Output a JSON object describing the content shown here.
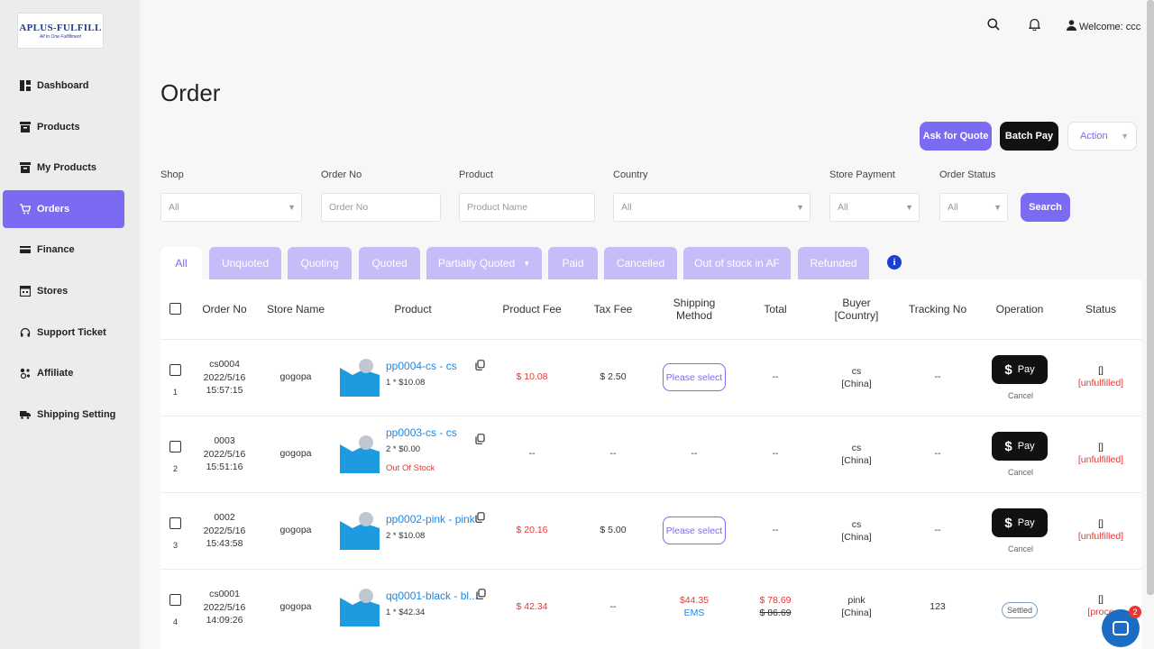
{
  "logo": {
    "line1": "APLUS-FULFILL",
    "line2": "All In One Fulfillment"
  },
  "sidebar": {
    "items": [
      {
        "label": "Dashboard",
        "icon": "dashboard-icon"
      },
      {
        "label": "Products",
        "icon": "box-icon"
      },
      {
        "label": "My Products",
        "icon": "box-icon"
      },
      {
        "label": "Orders",
        "icon": "cart-icon",
        "active": true
      },
      {
        "label": "Finance",
        "icon": "card-icon"
      },
      {
        "label": "Stores",
        "icon": "store-icon"
      },
      {
        "label": "Support Ticket",
        "icon": "headset-icon"
      },
      {
        "label": "Affiliate",
        "icon": "affiliate-icon"
      },
      {
        "label": "Shipping Setting",
        "icon": "truck-icon"
      }
    ]
  },
  "header": {
    "welcome": "Welcome:  ccc"
  },
  "page": {
    "title": "Order"
  },
  "actions": {
    "quote": "Ask for Quote",
    "batch_pay": "Batch Pay",
    "action": "Action"
  },
  "filters": {
    "shop": {
      "label": "Shop",
      "value": "All"
    },
    "order_no": {
      "label": "Order No",
      "placeholder": "Order No"
    },
    "product": {
      "label": "Product",
      "placeholder": "Product Name"
    },
    "country": {
      "label": "Country",
      "value": "All"
    },
    "store_payment": {
      "label": "Store Payment",
      "value": "All"
    },
    "order_status": {
      "label": "Order Status",
      "value": "All"
    },
    "search": "Search"
  },
  "tabs": [
    "All",
    "Unquoted",
    "Quoting",
    "Quoted",
    "Partially Quoted",
    "Paid",
    "Cancelled",
    "Out of stock in AF",
    "Refunded"
  ],
  "table": {
    "headers": {
      "order_no": "Order No",
      "store": "Store Name",
      "product": "Product",
      "product_fee": "Product Fee",
      "tax_fee": "Tax Fee",
      "shipping1": "Shipping",
      "shipping2": "Method",
      "total": "Total",
      "buyer1": "Buyer",
      "buyer2": "[Country]",
      "tracking": "Tracking No",
      "operation": "Operation",
      "status": "Status"
    },
    "rows": [
      {
        "num": "1",
        "order_no": "cs0004",
        "date": "2022/5/16",
        "time": "15:57:15",
        "store": "gogopa",
        "product": "pp0004-cs - cs",
        "qty": "1 * $10.08",
        "oos": "",
        "product_fee": "$ 10.08",
        "tax_fee": "$ 2.50",
        "shipping": "Please select",
        "ship_cost": "",
        "total": "--",
        "total_old": "",
        "buyer": "cs",
        "country": "[China]",
        "tracking": "--",
        "op": "Pay",
        "cancel": "Cancel",
        "status_top": "[]",
        "status": "[unfulfilled]"
      },
      {
        "num": "2",
        "order_no": "0003",
        "date": "2022/5/16",
        "time": "15:51:16",
        "store": "gogopa",
        "product": "pp0003-cs - cs",
        "qty": "2 * $0.00",
        "oos": "Out Of Stock",
        "product_fee": "--",
        "tax_fee": "--",
        "shipping": "--",
        "ship_cost": "",
        "total": "--",
        "total_old": "",
        "buyer": "cs",
        "country": "[China]",
        "tracking": "--",
        "op": "Pay",
        "cancel": "Cancel",
        "status_top": "[]",
        "status": "[unfulfilled]"
      },
      {
        "num": "3",
        "order_no": "0002",
        "date": "2022/5/16",
        "time": "15:43:58",
        "store": "gogopa",
        "product": "pp0002-pink - pink",
        "qty": "2 * $10.08",
        "oos": "",
        "product_fee": "$ 20.16",
        "tax_fee": "$ 5.00",
        "shipping": "Please select",
        "ship_cost": "",
        "total": "--",
        "total_old": "",
        "buyer": "cs",
        "country": "[China]",
        "tracking": "--",
        "op": "Pay",
        "cancel": "Cancel",
        "status_top": "[]",
        "status": "[unfulfilled]"
      },
      {
        "num": "4",
        "order_no": "cs0001",
        "date": "2022/5/16",
        "time": "14:09:26",
        "store": "gogopa",
        "product": "qq0001-black - bl...",
        "qty": "1 * $42.34",
        "oos": "",
        "product_fee": "$ 42.34",
        "tax_fee": "--",
        "shipping": "EMS",
        "ship_cost": "$44.35",
        "total": "$ 78.69",
        "total_old": "$ 86.69",
        "buyer": "pink",
        "country": "[China]",
        "tracking": "123",
        "op": "Settled",
        "cancel": "",
        "status_top": "[]",
        "status": "[proce"
      }
    ]
  },
  "chat": {
    "badge": "2"
  }
}
